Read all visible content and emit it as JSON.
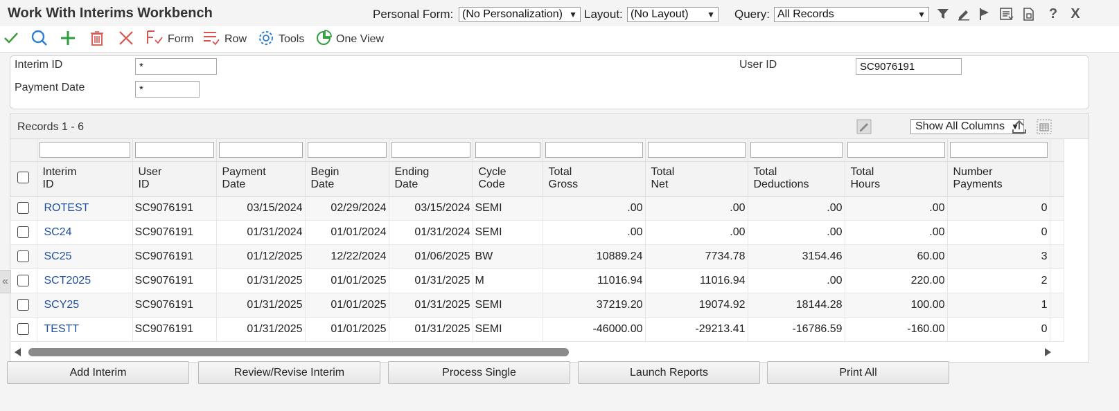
{
  "header": {
    "title": "Work With Interims Workbench",
    "personal_form_label": "Personal Form:",
    "personal_form_value": "(No Personalization)",
    "layout_label": "Layout:",
    "layout_value": "(No Layout)",
    "query_label": "Query:",
    "query_value": "All Records",
    "icons": [
      "filter-icon",
      "edit-pencil-icon",
      "flag-icon",
      "list-report-icon",
      "export-doc-icon",
      "help-icon",
      "close-icon"
    ],
    "close_glyph": "X",
    "help_glyph": "?"
  },
  "toolbar": {
    "form_label": "Form",
    "row_label": "Row",
    "tools_label": "Tools",
    "one_view_label": "One View"
  },
  "filters": {
    "interim_id_label": "Interim ID",
    "interim_id_value": "*",
    "payment_date_label": "Payment Date",
    "payment_date_value": "*",
    "user_id_label": "User ID",
    "user_id_value": "SC9076191"
  },
  "grid": {
    "records_label": "Records 1 - 6",
    "columns_select": "Show All Columns",
    "columns": [
      {
        "line1": "Interim",
        "line2": "ID"
      },
      {
        "line1": "User",
        "line2": "ID"
      },
      {
        "line1": "Payment",
        "line2": "Date"
      },
      {
        "line1": "Begin",
        "line2": "Date"
      },
      {
        "line1": "Ending",
        "line2": "Date"
      },
      {
        "line1": "Cycle",
        "line2": "Code"
      },
      {
        "line1": "Total",
        "line2": "Gross"
      },
      {
        "line1": "Total",
        "line2": "Net"
      },
      {
        "line1": "Total",
        "line2": "Deductions"
      },
      {
        "line1": "Total",
        "line2": "Hours"
      },
      {
        "line1": "Number",
        "line2": "Payments"
      }
    ],
    "rows": [
      [
        "ROTEST",
        "SC9076191",
        "03/15/2024",
        "02/29/2024",
        "03/15/2024",
        "SEMI",
        ".00",
        ".00",
        ".00",
        ".00",
        "0"
      ],
      [
        "SC24",
        "SC9076191",
        "01/31/2024",
        "01/01/2024",
        "01/31/2024",
        "SEMI",
        ".00",
        ".00",
        ".00",
        ".00",
        "0"
      ],
      [
        "SC25",
        "SC9076191",
        "01/12/2025",
        "12/22/2024",
        "01/06/2025",
        "BW",
        "10889.24",
        "7734.78",
        "3154.46",
        "60.00",
        "3"
      ],
      [
        "SCT2025",
        "SC9076191",
        "01/31/2025",
        "01/01/2025",
        "01/31/2025",
        "M",
        "11016.94",
        "11016.94",
        ".00",
        "220.00",
        "2"
      ],
      [
        "SCY25",
        "SC9076191",
        "01/31/2025",
        "01/01/2025",
        "01/31/2025",
        "SEMI",
        "37219.20",
        "19074.92",
        "18144.28",
        "100.00",
        "1"
      ],
      [
        "TESTT",
        "SC9076191",
        "01/31/2025",
        "01/01/2025",
        "01/31/2025",
        "SEMI",
        "-46000.00",
        "-29213.41",
        "-16786.59",
        "-160.00",
        "0"
      ]
    ]
  },
  "buttons": {
    "add_interim": "Add Interim",
    "review_revise": "Review/Revise Interim",
    "process_single": "Process Single",
    "launch_reports": "Launch Reports",
    "print_all": "Print All"
  },
  "colors": {
    "link": "#1f4f9f",
    "check_green": "#3a9a3a",
    "search_blue": "#2d7fd3",
    "add_green": "#2e9e3e",
    "delete_red": "#d9534f"
  }
}
